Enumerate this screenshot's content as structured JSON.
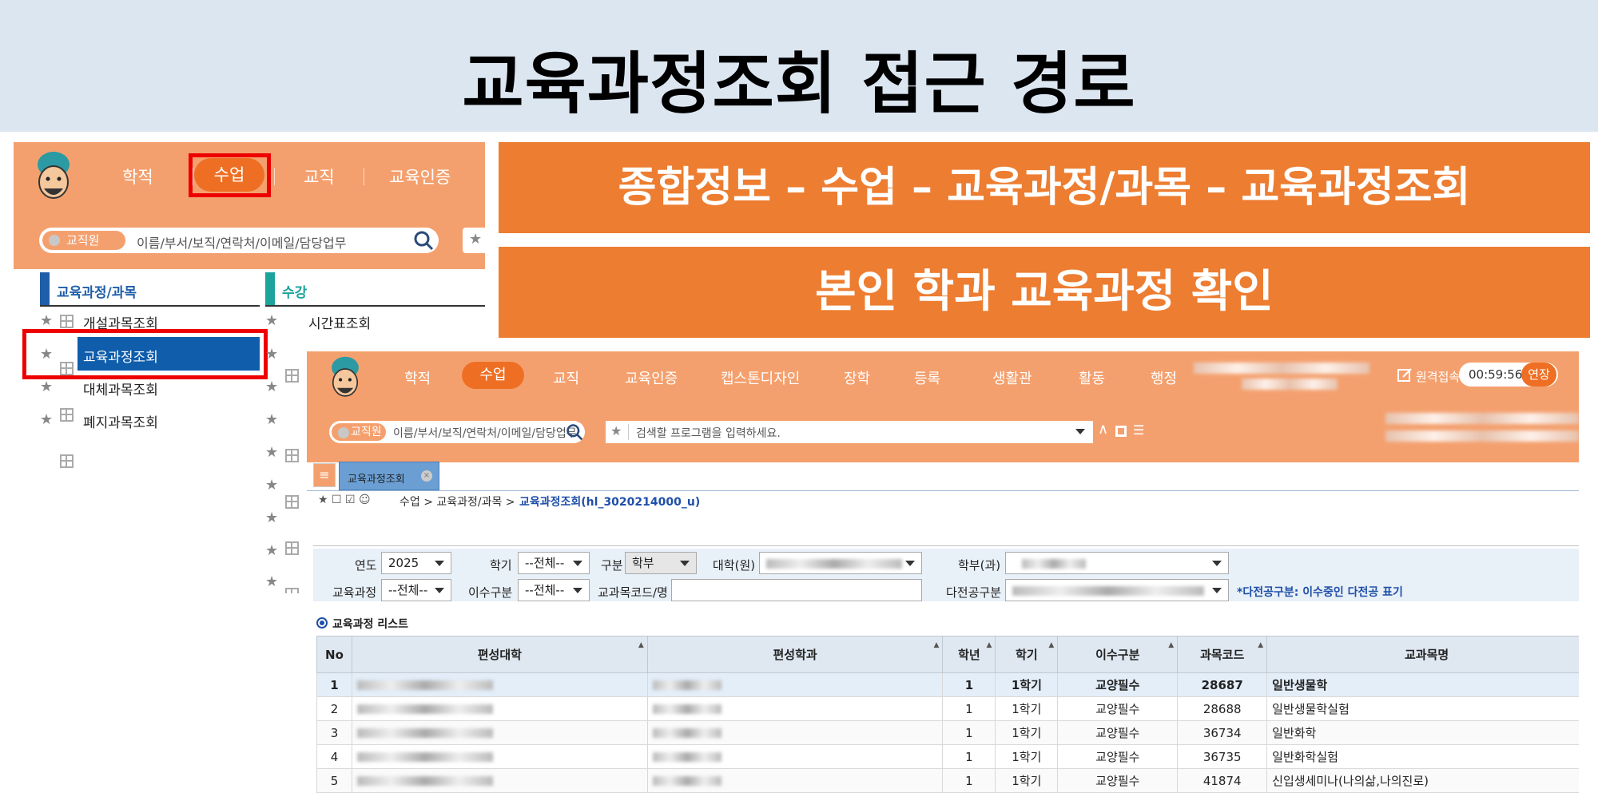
{
  "title": "교육과정조회 접근 경로",
  "left_panel": {
    "nav": [
      "학적",
      "수업",
      "교직",
      "교육인증"
    ],
    "active_nav": "수업",
    "role_badge": "교직원",
    "search_placeholder": "이름/부서/보직/연락처/이메일/담당업무",
    "section1": {
      "title": "교육과정/과목",
      "items": [
        "개설과목조회",
        "교육과정조회",
        "대체과목조회",
        "폐지과목조회"
      ],
      "highlighted": "교육과정조회"
    },
    "section2": {
      "title": "수강",
      "items": [
        "시간표조회"
      ]
    }
  },
  "path_box": "종합정보 – 수업 – 교육과정/과목 – 교육과정조회",
  "confirm_box": "본인 학과 교육과정 확인",
  "screenshot": {
    "nav": [
      "학적",
      "수업",
      "교직",
      "교육인증",
      "캡스톤디자인",
      "장학",
      "등록",
      "생활관",
      "활동",
      "행정"
    ],
    "active_nav": "수업",
    "remote_label": "원격접속",
    "timer": "00:59:56",
    "extend_label": "연장",
    "role_badge": "교직원",
    "search_placeholder": "이름/부서/보직/연락처/이메일/담당업무",
    "program_placeholder": "검색할 프로그램을 입력하세요.",
    "tab_label": "교육과정조회",
    "breadcrumb": "수업 > 교육과정/과목 >",
    "breadcrumb_current": "교육과정조회(hl_3020214000_u)",
    "filters": {
      "year_label": "연도",
      "year_value": "2025",
      "semester_label": "학기",
      "semester_value": "--전체--",
      "division_label": "구분",
      "division_value": "학부",
      "college_label": "대학(원)",
      "dept_label": "학부(과)",
      "curriculum_label": "교육과정",
      "curriculum_value": "--전체--",
      "completion_label": "이수구분",
      "completion_value": "--전체--",
      "course_code_label": "교과목코드/명",
      "multimajor_label": "다전공구분",
      "multimajor_note": "*다전공구분: 이수중인 다전공 표기"
    },
    "list_title": "교육과정 리스트",
    "table": {
      "headers": [
        "No",
        "편성대학",
        "편성학과",
        "학년",
        "학기",
        "이수구분",
        "과목코드",
        "교과목명"
      ],
      "rows": [
        [
          "1",
          "",
          "",
          "1",
          "1학기",
          "교양필수",
          "28687",
          "일반생물학"
        ],
        [
          "2",
          "",
          "",
          "1",
          "1학기",
          "교양필수",
          "28688",
          "일반생물학실험"
        ],
        [
          "3",
          "",
          "",
          "1",
          "1학기",
          "교양필수",
          "36734",
          "일반화학"
        ],
        [
          "4",
          "",
          "",
          "1",
          "1학기",
          "교양필수",
          "36735",
          "일반화학실험"
        ],
        [
          "5",
          "",
          "",
          "1",
          "1학기",
          "교양필수",
          "41874",
          "신입생세미나(나의삶,나의진로)"
        ]
      ]
    }
  }
}
